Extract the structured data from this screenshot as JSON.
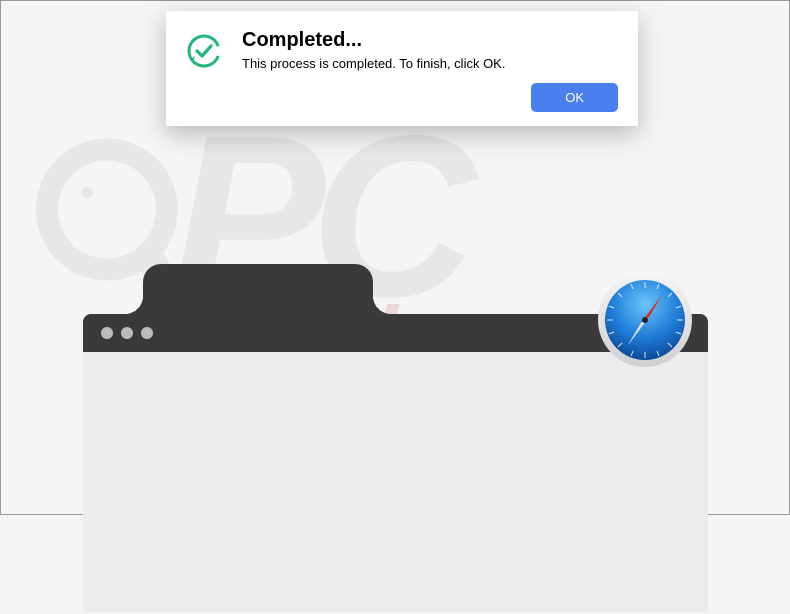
{
  "dialog": {
    "title": "Completed...",
    "message": "This process is completed. To finish, click OK.",
    "ok_label": "OK"
  },
  "watermark": {
    "top_text": "PC",
    "bottom_text": "risk.com"
  },
  "colors": {
    "dialog_button": "#4a7ff0",
    "check_icon": "#1fb878",
    "browser_chrome": "#3a3a3a",
    "browser_body": "#ececec"
  }
}
